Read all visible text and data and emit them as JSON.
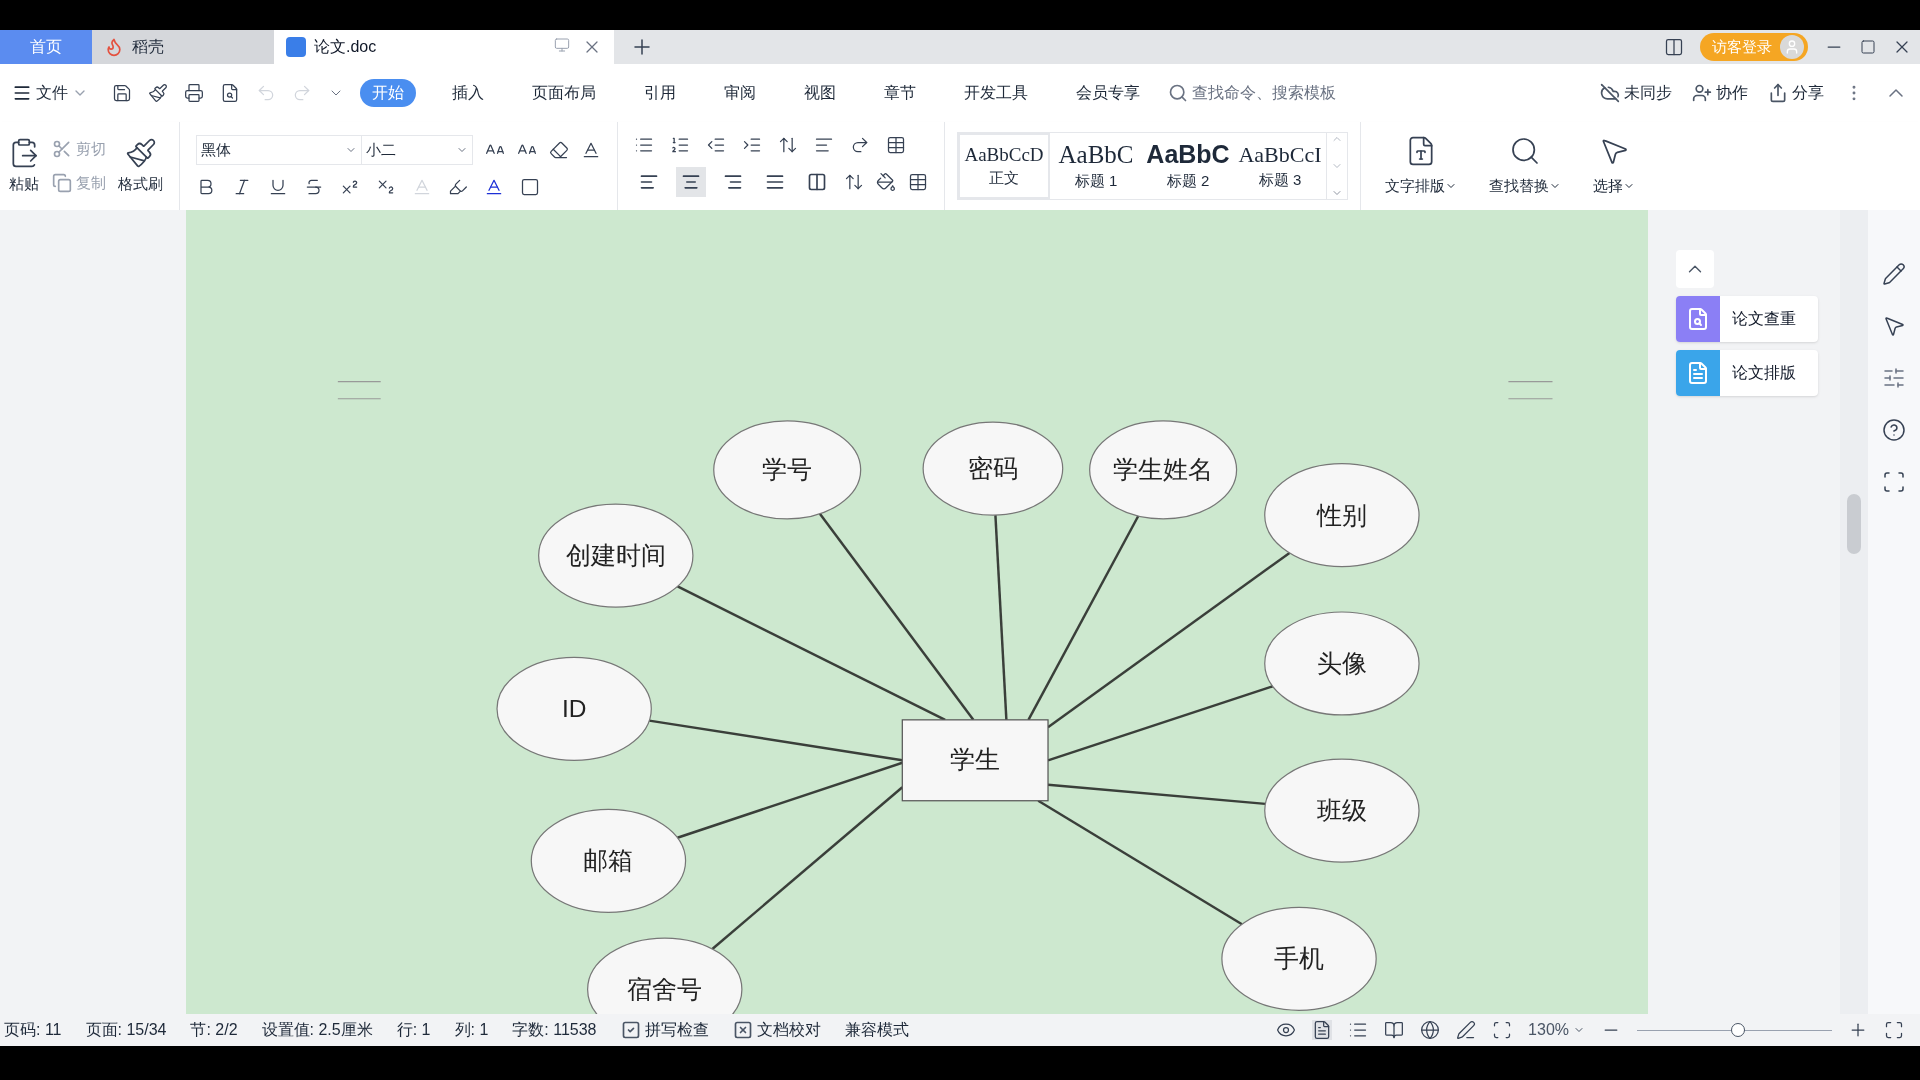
{
  "tabs": [
    {
      "label": "首页",
      "selected": false,
      "kind": "home"
    },
    {
      "label": "稻壳",
      "selected": false,
      "kind": "app"
    },
    {
      "label": "论文.doc",
      "selected": true,
      "kind": "doc"
    }
  ],
  "login_button": "访客登录",
  "menu": {
    "file": "文件",
    "tabs": [
      {
        "label": "开始",
        "selected": true
      },
      {
        "label": "插入",
        "selected": false
      },
      {
        "label": "页面布局",
        "selected": false
      },
      {
        "label": "引用",
        "selected": false
      },
      {
        "label": "审阅",
        "selected": false
      },
      {
        "label": "视图",
        "selected": false
      },
      {
        "label": "章节",
        "selected": false
      },
      {
        "label": "开发工具",
        "selected": false
      },
      {
        "label": "会员专享",
        "selected": false
      }
    ],
    "search": {
      "placeholder": "查找命令、搜索模板"
    },
    "actions": [
      "未同步",
      "协作",
      "分享"
    ]
  },
  "toolbar": {
    "paste": "粘贴",
    "clipboard": [
      {
        "label": "剪切",
        "disabled": true
      },
      {
        "label": "复制",
        "disabled": true
      }
    ],
    "format_painter": "格式刷",
    "font": "黑体",
    "font_size": "小二",
    "alignment": [
      {
        "selected": false
      },
      {
        "selected": true
      },
      {
        "selected": false
      },
      {
        "selected": false
      },
      {
        "selected": false
      }
    ],
    "styles": [
      {
        "sample": "AaBbCcD",
        "label": "正文",
        "selected": true
      },
      {
        "sample": "AaBbC",
        "label": "标题 1",
        "selected": false
      },
      {
        "sample": "AaBbC",
        "label": "标题 2",
        "selected": false
      },
      {
        "sample": "AaBbCcI",
        "label": "标题 3",
        "selected": false
      }
    ],
    "tools": [
      "文字排版",
      "查找替换",
      "选择"
    ]
  },
  "side_panel": [
    "论文查重",
    "论文排版"
  ],
  "diagram": {
    "entity": "学生",
    "attributes": [
      "学号",
      "密码",
      "学生姓名",
      "性别",
      "创建时间",
      "ID",
      "头像",
      "邮箱",
      "班级",
      "手机",
      "宿舍号"
    ]
  },
  "status_bar": {
    "items": [
      "页码: 11",
      "页面: 15/34",
      "节: 2/2",
      "设置值: 2.5厘米",
      "行: 1",
      "列: 1",
      "字数: 11538"
    ],
    "checks": [
      "拼写检查",
      "文档校对"
    ],
    "mode": "兼容模式",
    "zoom": "130%",
    "zoom_slider": {
      "level": 0.52
    }
  }
}
